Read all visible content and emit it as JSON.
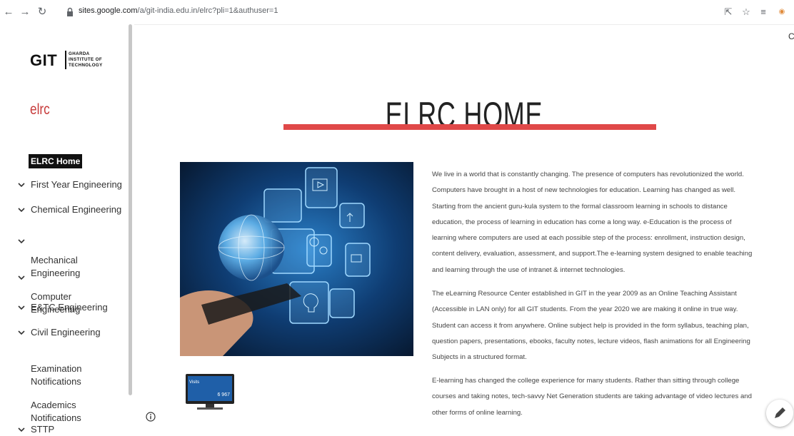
{
  "browser": {
    "url_domain": "sites.google.com",
    "url_path": "/a/git-india.edu.in/elrc?pli=1&authuser=1",
    "icons": [
      "back-icon",
      "forward-icon",
      "reload-icon",
      "lock-icon",
      "share-icon",
      "star-icon",
      "reading-list-icon",
      "profile-icon"
    ]
  },
  "logo": {
    "short": "GIT",
    "full": "GHARDA\nINSTITUTE OF\nTECHNOLOGY"
  },
  "site_name": "elrc",
  "nav": {
    "items": [
      {
        "label": "ELRC Home",
        "active": true,
        "expandable": false
      },
      {
        "label": "First Year Engineering",
        "active": false,
        "expandable": true
      },
      {
        "label": "Chemical Engineering",
        "active": false,
        "expandable": true
      },
      {
        "label": "Mechanical\nEngineering",
        "active": false,
        "expandable": true
      },
      {
        "label": "Computer\nEngineering",
        "active": false,
        "expandable": true
      },
      {
        "label": "E&TC Engineering",
        "active": false,
        "expandable": true
      },
      {
        "label": "Civil Engineering",
        "active": false,
        "expandable": true
      },
      {
        "label": "Examination\nNotifications",
        "active": false,
        "expandable": false
      },
      {
        "label": "Academics\nNotifications",
        "active": false,
        "expandable": false
      },
      {
        "label": "STTP",
        "active": false,
        "expandable": true
      }
    ]
  },
  "main": {
    "title": "ELRC HOME",
    "accent_color": "#e04848",
    "paragraphs": [
      "We live in a world that is constantly changing. The presence of computers has revolutionized the world. Computers have brought in a host of new technologies for education. Learning has changed as well. Starting from the ancient guru-kula system to the formal classroom learning in schools to distance education, the process of learning in education has come a long way. e-Education is the process of learning where computers are used at each possible step of the process: enrollment, instruction design, content delivery, evaluation, assessment, and support.The e-learning system designed to enable teaching and learning through the use of intranet & internet technologies.",
      "The eLearning Resource Center established in GIT in the year 2009 as an Online Teaching Assistant (Accessible in LAN only) for all GIT students. From the year 2020 we are making it online in true way. Student can access it from anywhere. Online subject help is provided in the form syllabus, teaching plan, question papers, presentations, ebooks, faculty notes, lecture videos, flash animations for all Engineering Subjects in a structured format.",
      "E-learning has changed the college experience for many students. Rather than sitting through college courses and taking notes, tech-savvy Net Generation students are taking advantage of video lectures and other forms of online learning."
    ],
    "visit_counter": {
      "label": "Visits",
      "count": "6 967"
    }
  },
  "corner_text": "C"
}
